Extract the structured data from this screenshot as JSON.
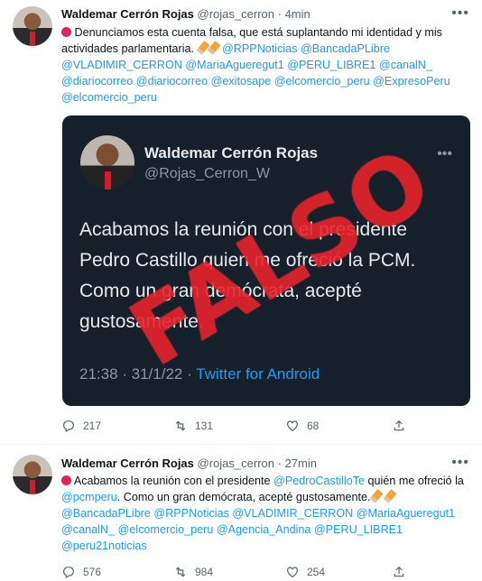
{
  "tweet1": {
    "name": "Waldemar Cerrón Rojas",
    "handle": "@rojas_cerron",
    "sep": "·",
    "time": "4min",
    "more": "•••",
    "text_start": "Denunciamos esta cuenta falsa, que está suplantando mi identidad y mis actividades parlamentaria.",
    "mentions": "@RPPNoticias @BancadaPLibre @VLADIMIR_CERRON @MariaAgueregut1 @PERU_LIBRE1 @canalN_ @diariocorreo @diariocorreo @exitosape @elcomercio_peru @ExpresoPeru @elcomercio_peru",
    "quoted": {
      "name": "Waldemar Cerrón Rojas",
      "handle": "@Rojas_Cerron_W",
      "more": "•••",
      "text": "Acabamos la reunión con el presidente Pedro Castillo quien me ofreció la PCM. Como un gran demócrata, acepté gustosamente.",
      "time": "21:38 · 31/1/22 · ",
      "source": "Twitter for Android",
      "stamp": "FALSO"
    },
    "replies": "217",
    "retweets": "131",
    "likes": "68"
  },
  "tweet2": {
    "name": "Waldemar Cerrón Rojas",
    "handle": "@rojas_cerron",
    "sep": "·",
    "time": "27min",
    "more": "•••",
    "text_a": "Acabamos la reunión con el presidente ",
    "mention_a": "@PedroCastilloTe",
    "text_b": " quién me ofreció la ",
    "mention_b": "@pcmperu",
    "text_c": ". Como un gran demócrata, acepté gustosamente.",
    "mentions": "@BancadaPLibre @RPPNoticias @VLADIMIR_CERRON @MariaAgueregut1 @canalN_ @elcomercio_peru @Agencia_Andina @PERU_LIBRE1 @peru21noticias",
    "replies": "576",
    "retweets": "984",
    "likes": "254"
  },
  "colors": {
    "link": "#1d9bf0",
    "muted": "#536471",
    "card_bg": "#15202b",
    "stamp": "#e8232b"
  }
}
